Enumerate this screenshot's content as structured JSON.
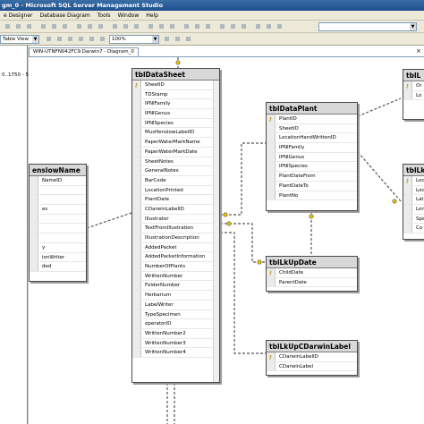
{
  "window": {
    "title": "gm_0 - Microsoft SQL Server Management Studio"
  },
  "menu": [
    "e Designer",
    "Database Diagram",
    "Tools",
    "Window",
    "Help"
  ],
  "toolbar": {
    "table_view": "Table View",
    "zoom": "100%"
  },
  "left_panel": {
    "value": "0..1750 - 5"
  },
  "document_tab": {
    "label": "WIN-UTNFN042FC9.Darwin7 - Diagram_0"
  },
  "tables": {
    "tblDataSheet": {
      "name": "tblDataSheet",
      "columns": [
        "SheetID",
        "TDStamp",
        "IPNIFamily",
        "IPNIGenus",
        "IPNISpecies",
        "MusHenslowLabelID",
        "PaperWaterMarkName",
        "PaperWaterMarkDate",
        "SheetNotes",
        "GeneralNotes",
        "BarCode",
        "LocationPrinted",
        "PlantDate",
        "CDarwinLabelID",
        "Illustrator",
        "TextFromIllustration",
        "IllustrationDescription",
        "AddedPacket",
        "AddedPacketInformation",
        "NumberOfPlants",
        "WrittenNumber",
        "FolderNumber",
        "Herbarium",
        "LabelWriter",
        "TypeSpecimen",
        "operatorID",
        "WrittenNumber2",
        "WrittenNumber3",
        "WrittenNumber4"
      ],
      "key_column": 0
    },
    "tblDataPlant": {
      "name": "tblDataPlant",
      "columns": [
        "PlantID",
        "SheetID",
        "LocationHandWrittenID",
        "IPNIFamily",
        "IPNIGenus",
        "IPNISpecies",
        "PlantDateFrom",
        "PlantDateTo",
        "PlantNo"
      ],
      "key_column": 0
    },
    "tblLkUpDate": {
      "name": "tblLkUpDate",
      "columns": [
        "ChildDate",
        "ParentDate"
      ],
      "key_column": 0
    },
    "tblLkUpCDarwinLabel": {
      "name": "tblLkUpCDarwinLabel",
      "columns": [
        "CDarwinLabelID",
        "CDarwinLabel"
      ],
      "key_column": 0
    },
    "henslow": {
      "name": "enslowName",
      "columns": [
        "NameID",
        "",
        "",
        "es",
        "",
        "",
        "",
        "y",
        "ionWriter",
        "ded"
      ],
      "key_column": -1
    },
    "right_top": {
      "name": "tblL",
      "columns": [
        "Or",
        "Lo"
      ],
      "key_column": 0
    },
    "right_mid": {
      "name": "tblLk",
      "columns": [
        "Loc",
        "Loc",
        "Lat",
        "Lon",
        "Spe",
        "Co"
      ],
      "key_column": 0
    }
  },
  "colors": {
    "title_bar": "#1e4f8c",
    "table_header": "#d8d8d8",
    "key": "#b58900"
  }
}
